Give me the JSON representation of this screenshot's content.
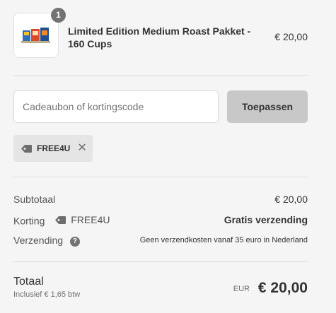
{
  "product": {
    "quantity": "1",
    "name": "Limited Edition Medium Roast Pakket - 160 Cups",
    "price": "€ 20,00",
    "image_icon": "coffee-package-thumbnail"
  },
  "discount_form": {
    "placeholder": "Cadeaubon of kortingscode",
    "apply_label": "Toepassen"
  },
  "applied_code": {
    "code": "FREE4U",
    "remove_icon": "close-icon"
  },
  "summary": {
    "subtotal_label": "Subtotaal",
    "subtotal_value": "€ 20,00",
    "discount_label": "Korting",
    "discount_code": "FREE4U",
    "discount_value": "Gratis verzending",
    "shipping_label": "Verzending",
    "shipping_help": "?",
    "shipping_value": "Geen verzendkosten vanaf 35 euro in Nederland"
  },
  "total": {
    "label": "Totaal",
    "tax_note": "Inclusief € 1,65 btw",
    "currency": "EUR",
    "amount": "€ 20,00"
  },
  "colors": {
    "background": "#f5f5f5",
    "button": "#c8c8c8",
    "chip": "#e5e5e5",
    "badge": "#737373"
  }
}
